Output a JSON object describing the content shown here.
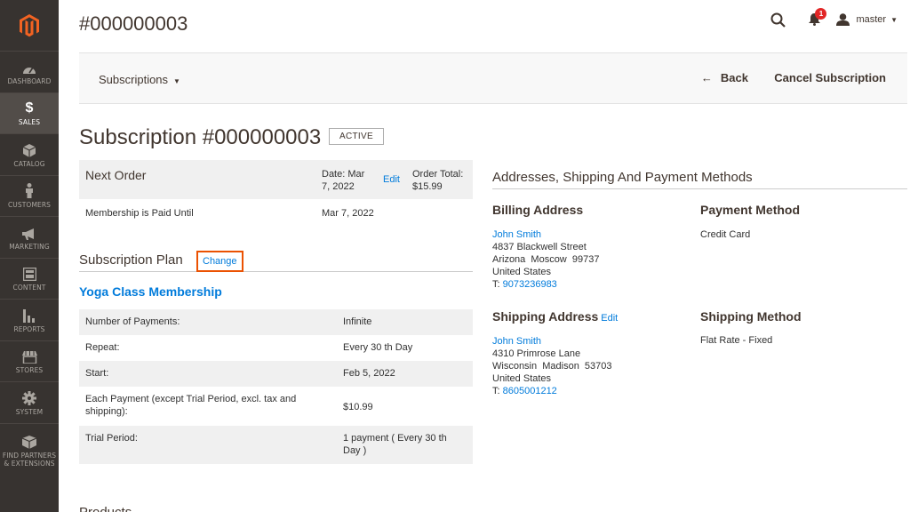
{
  "sidebar": {
    "items": [
      {
        "label": "DASHBOARD",
        "icon": "dashboard-icon"
      },
      {
        "label": "$",
        "label2": "SALES",
        "icon": "dollar-icon"
      },
      {
        "label": "CATALOG",
        "icon": "cube-icon"
      },
      {
        "label": "CUSTOMERS",
        "icon": "person-icon"
      },
      {
        "label": "MARKETING",
        "icon": "megaphone-icon"
      },
      {
        "label": "CONTENT",
        "icon": "layout-icon"
      },
      {
        "label": "REPORTS",
        "icon": "bar-chart-icon"
      },
      {
        "label": "STORES",
        "icon": "store-icon"
      },
      {
        "label": "SYSTEM",
        "icon": "gear-icon"
      },
      {
        "label": "FIND PARTNERS",
        "label2": "& EXTENSIONS",
        "icon": "box-icon"
      }
    ]
  },
  "header": {
    "page_id": "#000000003",
    "notifications_count": "1",
    "user_name": "master"
  },
  "action_bar": {
    "dropdown_label": "Subscriptions",
    "back_label": "Back",
    "cancel_label": "Cancel Subscription"
  },
  "subscription": {
    "title": "Subscription #000000003",
    "status": "ACTIVE"
  },
  "next_order": {
    "title": "Next Order",
    "date_text": "Date: Mar 7, 2022",
    "edit_label": "Edit",
    "total_text": "Order Total: $15.99",
    "paid_until_label": "Membership is Paid Until",
    "paid_until_value": "Mar 7, 2022"
  },
  "plan": {
    "heading": "Subscription Plan",
    "change_label": "Change",
    "name": "Yoga Class Membership",
    "rows": [
      {
        "k": "Number of Payments:",
        "v": "Infinite"
      },
      {
        "k": "Repeat:",
        "v": "Every 30 th Day"
      },
      {
        "k": "Start:",
        "v": "Feb 5, 2022"
      },
      {
        "k": "Each Payment (except Trial Period, excl. tax and shipping):",
        "v": "$10.99"
      },
      {
        "k": "Trial Period:",
        "v": "1 payment ( Every 30 th Day )"
      }
    ]
  },
  "products_heading": "Products",
  "addresses": {
    "heading": "Addresses, Shipping And Payment Methods",
    "billing": {
      "title": "Billing Address",
      "name": "John Smith",
      "street": "4837 Blackwell Street",
      "city_line": "Arizona  Moscow  99737",
      "country": "United States",
      "phone_prefix": "T: ",
      "phone": "9073236983"
    },
    "payment": {
      "title": "Payment Method",
      "value": "Credit Card"
    },
    "shipping": {
      "title": "Shipping Address",
      "edit_label": "Edit",
      "name": "John Smith",
      "street": "4310 Primrose Lane",
      "city_line": "Wisconsin  Madison  53703",
      "country": "United States",
      "phone_prefix": "T: ",
      "phone": "8605001212"
    },
    "shipping_method": {
      "title": "Shipping Method",
      "value": "Flat Rate - Fixed"
    }
  },
  "colors": {
    "sidebar_bg": "#373330",
    "accent_orange": "#eb5202",
    "link_blue": "#007bdb"
  }
}
